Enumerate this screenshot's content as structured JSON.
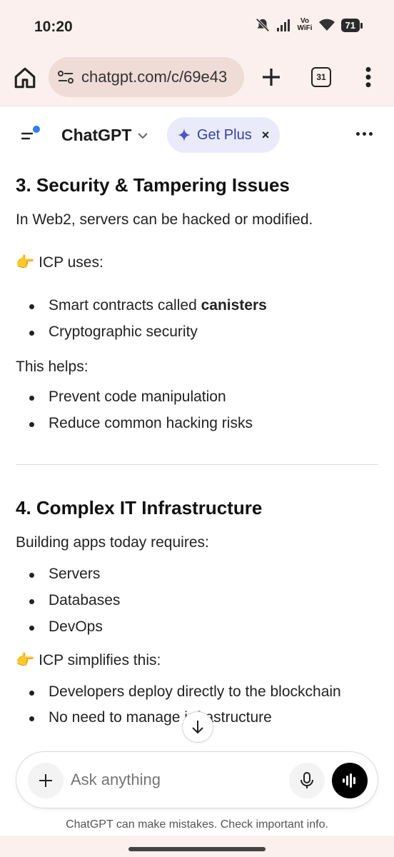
{
  "status_bar": {
    "time": "10:20",
    "vowifi_top": "Vo",
    "vowifi_bottom": "WiFi",
    "battery": "71"
  },
  "browser": {
    "url": "chatgpt.com/c/69e43",
    "tab_count": "31"
  },
  "app_header": {
    "title": "ChatGPT",
    "get_plus": "Get Plus",
    "close": "×"
  },
  "content": {
    "section3_title": "3. Security & Tampering Issues",
    "section3_intro": "In Web2, servers can be hacked or modified.",
    "icp_uses": "ICP uses:",
    "icp_uses_items": [
      {
        "text": "Smart contracts called ",
        "bold": "canisters"
      },
      {
        "text": "Cryptographic security"
      }
    ],
    "this_helps": "This helps:",
    "this_helps_items": [
      "Prevent code manipulation",
      "Reduce common hacking risks"
    ],
    "section4_title": "4. Complex IT Infrastructure",
    "section4_intro": "Building apps today requires:",
    "requires_items": [
      "Servers",
      "Databases",
      "DevOps"
    ],
    "icp_simplifies": "ICP simplifies this:",
    "simplifies_items": [
      "Developers deploy directly to the blockchain",
      "No need to manage infrastructure"
    ],
    "pointer_emoji": "👉"
  },
  "composer": {
    "placeholder": "Ask anything"
  },
  "disclaimer": "ChatGPT can make mistakes. Check important info."
}
